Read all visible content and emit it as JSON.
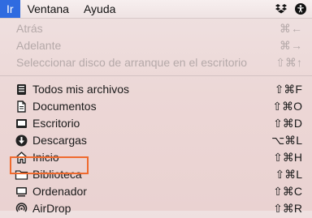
{
  "menubar": {
    "items": [
      {
        "label": "Ir"
      },
      {
        "label": "Ventana"
      },
      {
        "label": "Ayuda"
      }
    ],
    "status_icons": [
      "dropbox-icon",
      "accessibility-icon"
    ]
  },
  "menu": {
    "items_disabled": [
      {
        "label": "Atrás",
        "shortcut": "⌘←"
      },
      {
        "label": "Adelante",
        "shortcut": "⌘→"
      },
      {
        "label": "Seleccionar disco de arranque en el escritorio",
        "shortcut": "⇧⌘↑"
      }
    ],
    "items": [
      {
        "label": "Todos mis archivos",
        "shortcut": "⇧⌘F",
        "icon": "all-files-icon"
      },
      {
        "label": "Documentos",
        "shortcut": "⇧⌘O",
        "icon": "documents-icon"
      },
      {
        "label": "Escritorio",
        "shortcut": "⇧⌘D",
        "icon": "desktop-icon"
      },
      {
        "label": "Descargas",
        "shortcut": "⌥⌘L",
        "icon": "downloads-icon"
      },
      {
        "label": "Inicio",
        "shortcut": "⇧⌘H",
        "icon": "home-icon"
      },
      {
        "label": "Biblioteca",
        "shortcut": "⇧⌘L",
        "icon": "library-folder-icon"
      },
      {
        "label": "Ordenador",
        "shortcut": "⇧⌘C",
        "icon": "computer-icon"
      },
      {
        "label": "AirDrop",
        "shortcut": "⇧⌘R",
        "icon": "airdrop-icon"
      }
    ]
  },
  "colors": {
    "menubar_active": "#2f6be0",
    "highlight": "#ef6a2e",
    "disabled_text": "#b5a9a9"
  }
}
